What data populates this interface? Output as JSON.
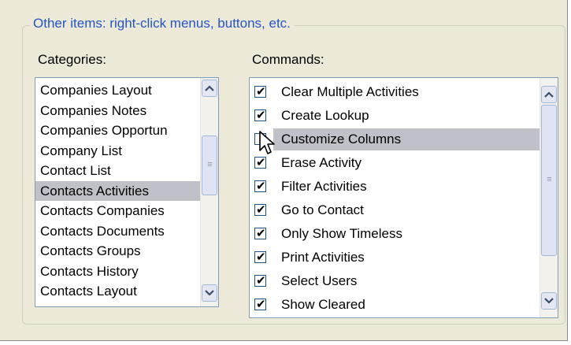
{
  "group": {
    "title": "Other items: right-click menus, buttons, etc."
  },
  "categories": {
    "label": "Categories:",
    "items": [
      {
        "label": "Companies Layout",
        "selected": false
      },
      {
        "label": "Companies Notes",
        "selected": false
      },
      {
        "label": "Companies Opportun",
        "selected": false
      },
      {
        "label": "Company List",
        "selected": false
      },
      {
        "label": "Contact List",
        "selected": false
      },
      {
        "label": "Contacts Activities",
        "selected": true
      },
      {
        "label": "Contacts Companies",
        "selected": false
      },
      {
        "label": "Contacts Documents",
        "selected": false
      },
      {
        "label": "Contacts Groups",
        "selected": false
      },
      {
        "label": "Contacts History",
        "selected": false
      },
      {
        "label": "Contacts Layout",
        "selected": false
      }
    ],
    "scroll_up_icon": "scroll-up-arrow",
    "scroll_down_icon": "scroll-down-arrow"
  },
  "commands": {
    "label": "Commands:",
    "items": [
      {
        "label": "Clear Multiple Activities",
        "checked": true,
        "selected": false
      },
      {
        "label": "Create Lookup",
        "checked": true,
        "selected": false
      },
      {
        "label": "Customize Columns",
        "checked": false,
        "selected": true
      },
      {
        "label": "Erase Activity",
        "checked": true,
        "selected": false
      },
      {
        "label": "Filter Activities",
        "checked": true,
        "selected": false
      },
      {
        "label": "Go to Contact",
        "checked": true,
        "selected": false
      },
      {
        "label": "Only Show Timeless",
        "checked": true,
        "selected": false
      },
      {
        "label": "Print Activities",
        "checked": true,
        "selected": false
      },
      {
        "label": "Select Users",
        "checked": true,
        "selected": false
      },
      {
        "label": "Show Cleared",
        "checked": true,
        "selected": false
      }
    ]
  },
  "colors": {
    "group_title": "#2455c3",
    "selection": "#c0c0c8",
    "window_bg": "#ece9d8",
    "list_border": "#7f9db9"
  }
}
